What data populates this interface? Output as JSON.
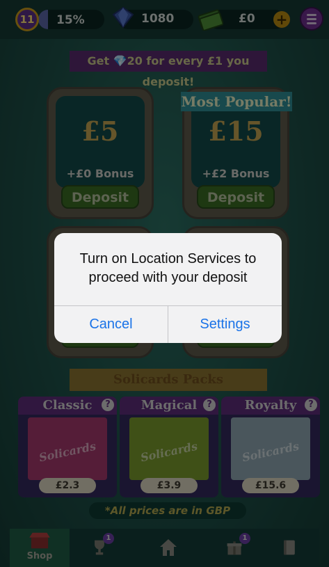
{
  "topbar": {
    "level": "11",
    "xp_percent_text": "15%",
    "xp_progress": 0.15,
    "gems": "1080",
    "cash": "£0",
    "plus_label": "+",
    "menu_icon": "hamburger-icon"
  },
  "promo": {
    "text": "Get 💎20 for every £1 you deposit!"
  },
  "deposits": [
    {
      "amount": "£5",
      "bonus": "+£0 Bonus",
      "button": "Deposit"
    },
    {
      "amount": "£15",
      "bonus": "+£2 Bonus",
      "button": "Deposit",
      "tag": "Most Popular!"
    }
  ],
  "packs": {
    "banner": "Solicards Packs",
    "items": [
      {
        "title": "Classic",
        "logo": "Solicards",
        "price": "£2.3",
        "help": "?"
      },
      {
        "title": "Magical",
        "logo": "Solicards",
        "price": "£3.9",
        "help": "?"
      },
      {
        "title": "Royalty",
        "logo": "Solicards",
        "price": "£15.6",
        "help": "?"
      }
    ]
  },
  "note": "*All prices are in GBP",
  "nav": {
    "shop_label": "Shop",
    "trophy_badge": "1",
    "gift_badge": "1"
  },
  "alert": {
    "message": "Turn on Location Services to proceed with your deposit",
    "cancel": "Cancel",
    "settings": "Settings"
  },
  "colors": {
    "ios_blue": "#1a73e8",
    "deposit_green": "#3b6b23",
    "purple": "#5d2c7a"
  }
}
